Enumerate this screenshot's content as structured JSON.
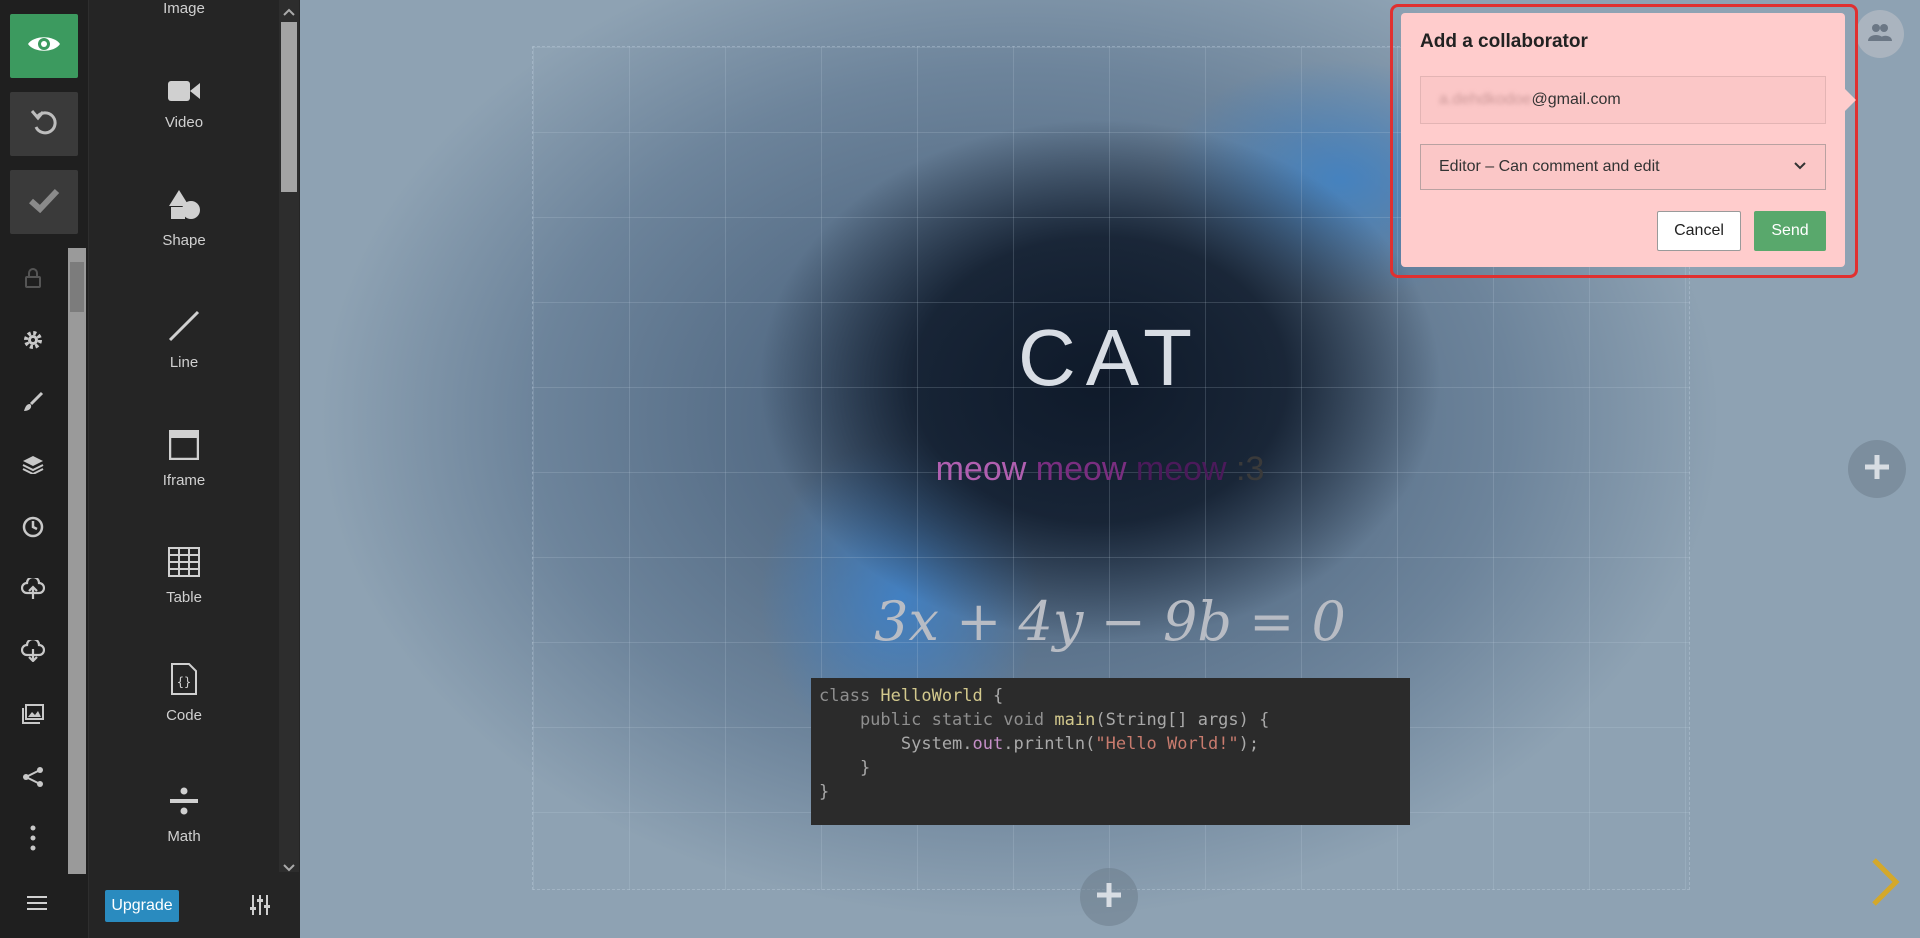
{
  "sidebar": {
    "top_buttons": [
      "eye-icon",
      "undo-icon",
      "check-icon"
    ],
    "icons": [
      "lock-icon",
      "gear-icon",
      "brush-icon",
      "layers-icon",
      "clock-icon",
      "cloud-upload-icon",
      "cloud-download-icon",
      "image-gallery-icon",
      "share-icon",
      "more-vertical-icon"
    ],
    "menu_icon": "hamburger-menu-icon"
  },
  "insert_panel": {
    "items": [
      {
        "label": "Image",
        "icon": "image-icon"
      },
      {
        "label": "Video",
        "icon": "video-icon"
      },
      {
        "label": "Shape",
        "icon": "shape-icon"
      },
      {
        "label": "Line",
        "icon": "line-icon"
      },
      {
        "label": "Iframe",
        "icon": "iframe-icon"
      },
      {
        "label": "Table",
        "icon": "table-icon"
      },
      {
        "label": "Code",
        "icon": "code-icon"
      },
      {
        "label": "Math",
        "icon": "math-divide-icon"
      }
    ],
    "upgrade_label": "Upgrade",
    "settings_icon": "sliders-icon"
  },
  "slide": {
    "title": "CAT",
    "meow": {
      "part1": "meow ",
      "part2": "meow ",
      "part3": "meow ",
      "part4": ":3",
      "colors": [
        "#b05fb0",
        "#7a2e80",
        "#4b1a5a",
        "#3a3a3a"
      ]
    },
    "math_text": "3x + 4y − 9b = 0",
    "code": {
      "line1_kw": "class ",
      "line1_cls": "HelloWorld",
      "line1_end": " {",
      "line2_kw": "    public static void ",
      "line2_fn": "main",
      "line2_end": "(String[] args) {",
      "line3_pre": "        System.",
      "line3_fld": "out",
      "line3_mid": ".println(",
      "line3_str": "\"Hello World!\"",
      "line3_end": ");",
      "line4": "    }",
      "line5": "}"
    }
  },
  "collaborator_popup": {
    "title": "Add a collaborator",
    "email_blurred": "a.dehdkodoe",
    "email_domain": "@gmail.com",
    "role_value": "Editor – Can comment and edit",
    "cancel_label": "Cancel",
    "send_label": "Send"
  },
  "colors": {
    "accent_green": "#3c9a5f",
    "popup_bg": "#ffcccc",
    "send_green": "#59a86c",
    "upgrade_blue": "#2a8bbf",
    "next_arrow": "#d4a82a"
  }
}
